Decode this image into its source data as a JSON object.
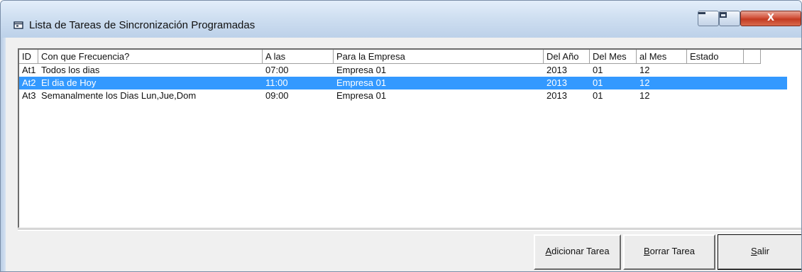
{
  "window": {
    "title": "Lista de Tareas de Sincronización Programadas",
    "close_glyph": "X",
    "accent": "#3399ff"
  },
  "list": {
    "columns": [
      "ID",
      "Con que Frecuencia?",
      "A las",
      "Para la Empresa",
      "Del Año",
      "Del Mes",
      "al Mes",
      "Estado"
    ],
    "rows": [
      {
        "id": "At1",
        "freq": "Todos los dias",
        "time": "07:00",
        "company": "Empresa 01",
        "year": "2013",
        "from_month": "01",
        "to_month": "12",
        "status": ""
      },
      {
        "id": "At2",
        "freq": "El dia de Hoy",
        "time": "11:00",
        "company": "Empresa 01",
        "year": "2013",
        "from_month": "01",
        "to_month": "12",
        "status": ""
      },
      {
        "id": "At3",
        "freq": "Semanalmente los Dias Lun,Jue,Dom",
        "time": "09:00",
        "company": "Empresa 01",
        "year": "2013",
        "from_month": "01",
        "to_month": "12",
        "status": ""
      }
    ],
    "selected_row": "At2"
  },
  "buttons": {
    "add": {
      "mnemonic": "A",
      "rest": "dicionar Tarea"
    },
    "delete": {
      "mnemonic": "B",
      "rest": "orrar Tarea"
    },
    "exit": {
      "mnemonic": "S",
      "rest": "alir"
    }
  }
}
